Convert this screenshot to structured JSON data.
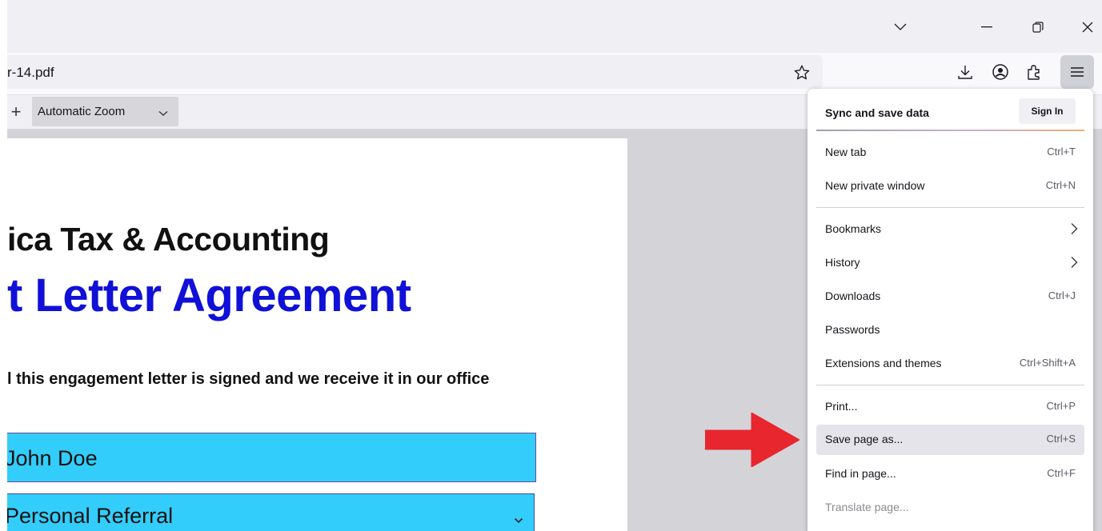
{
  "browser": {
    "url_text": "r-14.pdf",
    "titlebar_icons": [
      "chevron-down-icon",
      "minimize-icon",
      "restore-icon",
      "close-icon"
    ],
    "nav_icons": [
      "star-icon",
      "download-icon",
      "account-icon",
      "extensions-icon",
      "hamburger-menu-icon"
    ]
  },
  "pdf_toolbar": {
    "zoom_in_glyph": "+",
    "zoom_value": "Automatic Zoom"
  },
  "document": {
    "heading_1": "ica Tax & Accounting",
    "heading_2": "t Letter Agreement",
    "body_text": "l this engagement letter is signed and we receive it in our office",
    "name_field_value": "John Doe",
    "referral_select_value": "Personal Referral",
    "field_color": "#33cdfb",
    "heading_2_color": "#1010d8"
  },
  "annotation": {
    "arrow_color": "#e8262e"
  },
  "app_menu": {
    "header_label": "Sync and save data",
    "sign_in_label": "Sign In",
    "items": [
      {
        "label": "New tab",
        "shortcut": "Ctrl+T"
      },
      {
        "label": "New private window",
        "shortcut": "Ctrl+N"
      },
      {
        "label": "Bookmarks",
        "shortcut": ""
      },
      {
        "label": "History",
        "shortcut": ""
      },
      {
        "label": "Downloads",
        "shortcut": "Ctrl+J"
      },
      {
        "label": "Passwords",
        "shortcut": ""
      },
      {
        "label": "Extensions and themes",
        "shortcut": "Ctrl+Shift+A"
      },
      {
        "label": "Print...",
        "shortcut": "Ctrl+P"
      },
      {
        "label": "Save page as...",
        "shortcut": "Ctrl+S"
      },
      {
        "label": "Find in page...",
        "shortcut": "Ctrl+F"
      },
      {
        "label": "Translate page...",
        "shortcut": ""
      }
    ]
  }
}
